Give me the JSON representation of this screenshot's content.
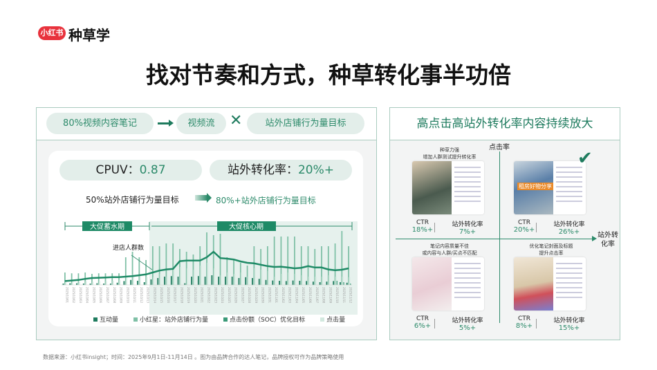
{
  "brand": {
    "pill": "小红书",
    "name": "种草学"
  },
  "title": "找对节奏和方式，种草转化事半功倍",
  "left": {
    "flow": [
      "80%视频内容笔记",
      "视频流",
      "站外店铺行为量目标"
    ],
    "stats": [
      {
        "label": "CPUV：",
        "value": "0.87"
      },
      {
        "label": "站外转化率：",
        "value": "20%+"
      }
    ],
    "from": "50%站外店铺行为量目标",
    "to": "80%+站外店铺行为量目标",
    "phase1": "大促蓄水期",
    "phase2": "大促核心期",
    "annotation": "进店人群数"
  },
  "chart_data": {
    "type": "bar",
    "categories": [
      "2025/10/01",
      "2025/10/02",
      "2025/10/03",
      "2025/10/04",
      "2025/10/05",
      "2025/10/06",
      "2025/10/07",
      "2025/10/08",
      "2025/10/09",
      "2025/10/10",
      "2025/10/11",
      "2025/10/12",
      "2025/10/13",
      "2025/10/14",
      "2025/10/15",
      "2025/10/16",
      "2025/10/17",
      "2025/10/18",
      "2025/10/19",
      "2025/10/20",
      "2025/10/21",
      "2025/10/22",
      "2025/10/23",
      "2025/10/24",
      "2025/10/25",
      "2025/10/26",
      "2025/10/27",
      "2025/10/28",
      "2025/10/29",
      "2025/10/30",
      "2025/10/31",
      "2025/11/01",
      "2025/11/02",
      "2025/11/03",
      "2025/11/04",
      "2025/11/05",
      "2025/11/06",
      "2025/11/07",
      "2025/11/08",
      "2025/11/09",
      "2025/11/10",
      "2025/11/11",
      "2025/11/12"
    ],
    "series": [
      {
        "name": "互动量",
        "color": "#1e7b5e",
        "values": [
          5,
          6,
          6,
          5,
          5,
          6,
          5,
          5,
          8,
          14,
          18,
          15,
          10,
          20,
          25,
          30,
          32,
          30,
          6,
          30,
          32,
          30,
          35,
          30,
          30,
          30,
          25,
          28,
          25,
          22,
          18,
          16,
          15,
          14,
          16,
          15,
          14,
          12,
          10,
          12,
          14,
          10,
          8
        ]
      },
      {
        "name": "小红星：站外店铺行为量",
        "color": "#7fc0a6",
        "values": [
          45,
          42,
          42,
          45,
          40,
          42,
          42,
          42,
          42,
          100,
          120,
          100,
          90,
          140,
          140,
          150,
          150,
          130,
          120,
          110,
          140,
          190,
          180,
          185,
          100,
          90,
          80,
          70,
          140,
          130,
          140,
          175,
          175,
          175,
          175,
          140,
          140,
          130,
          140,
          140,
          150,
          195,
          140
        ]
      },
      {
        "name": "点击份额（SOC）优化目标",
        "color": "#3a9a78",
        "values": [
          0,
          0,
          0,
          0,
          0,
          0,
          0,
          0,
          0,
          0,
          0,
          0,
          0,
          0,
          0,
          0,
          0,
          0,
          0,
          0,
          0,
          0,
          0,
          0,
          0,
          0,
          0,
          0,
          0,
          0,
          0,
          0,
          0,
          0,
          0,
          0,
          0,
          0,
          0,
          0,
          15,
          10,
          5
        ]
      },
      {
        "name": "点击量",
        "color": "#d3e9df",
        "values": [
          12,
          12,
          12,
          14,
          12,
          14,
          14,
          15,
          18,
          30,
          38,
          35,
          30,
          28,
          40,
          30,
          60,
          65,
          60,
          55,
          70,
          80,
          60,
          35,
          45,
          40,
          45,
          30,
          60,
          55,
          50,
          30,
          40,
          45,
          40,
          35,
          30,
          30,
          30,
          35,
          30,
          30,
          28
        ]
      },
      {
        "name": "进店人群数",
        "type": "line",
        "color": "#1e8a66",
        "values": [
          14,
          16,
          18,
          22,
          25,
          26,
          27,
          28,
          28,
          30,
          32,
          35,
          38,
          45,
          52,
          56,
          58,
          86,
          88,
          88,
          88,
          100,
          120,
          97,
          95,
          92,
          85,
          80,
          78,
          73,
          68,
          65,
          66,
          63,
          60,
          62,
          68,
          63,
          63,
          56,
          53,
          55,
          60
        ]
      }
    ],
    "ylim": [
      0,
      200
    ]
  },
  "right": {
    "title": "高点击高站外转化率内容持续放大",
    "yaxis": "点击率",
    "xaxis": "站外转化率",
    "quadrants": [
      {
        "caption": "种草力强\n增加人群测试提升转化率",
        "ctr_label": "CTR",
        "ctr": "18%+",
        "cvr_label": "站外转化率",
        "cvr": "7%+"
      },
      {
        "caption": "",
        "ctr_label": "CTR",
        "ctr": "20%+",
        "cvr_label": "站外转化率",
        "cvr": "26%+",
        "badge": "check-icon",
        "overlay": "租房好物分享"
      },
      {
        "caption": "笔记内容质量不佳\n或内容与人群/买点不匹配",
        "ctr_label": "CTR",
        "ctr": "6%+",
        "cvr_label": "站外转化率",
        "cvr": "5%+"
      },
      {
        "caption": "优化笔记封面及标题\n提升点击率",
        "ctr_label": "CTR",
        "ctr": "8%+",
        "cvr_label": "站外转化率",
        "cvr": "15%+"
      }
    ]
  },
  "footer": "数据来源：小红书insight；时间：2025年9月1日-11月14日 。图为由品牌合作的达人笔记，品牌授权可作为品牌策略使用"
}
